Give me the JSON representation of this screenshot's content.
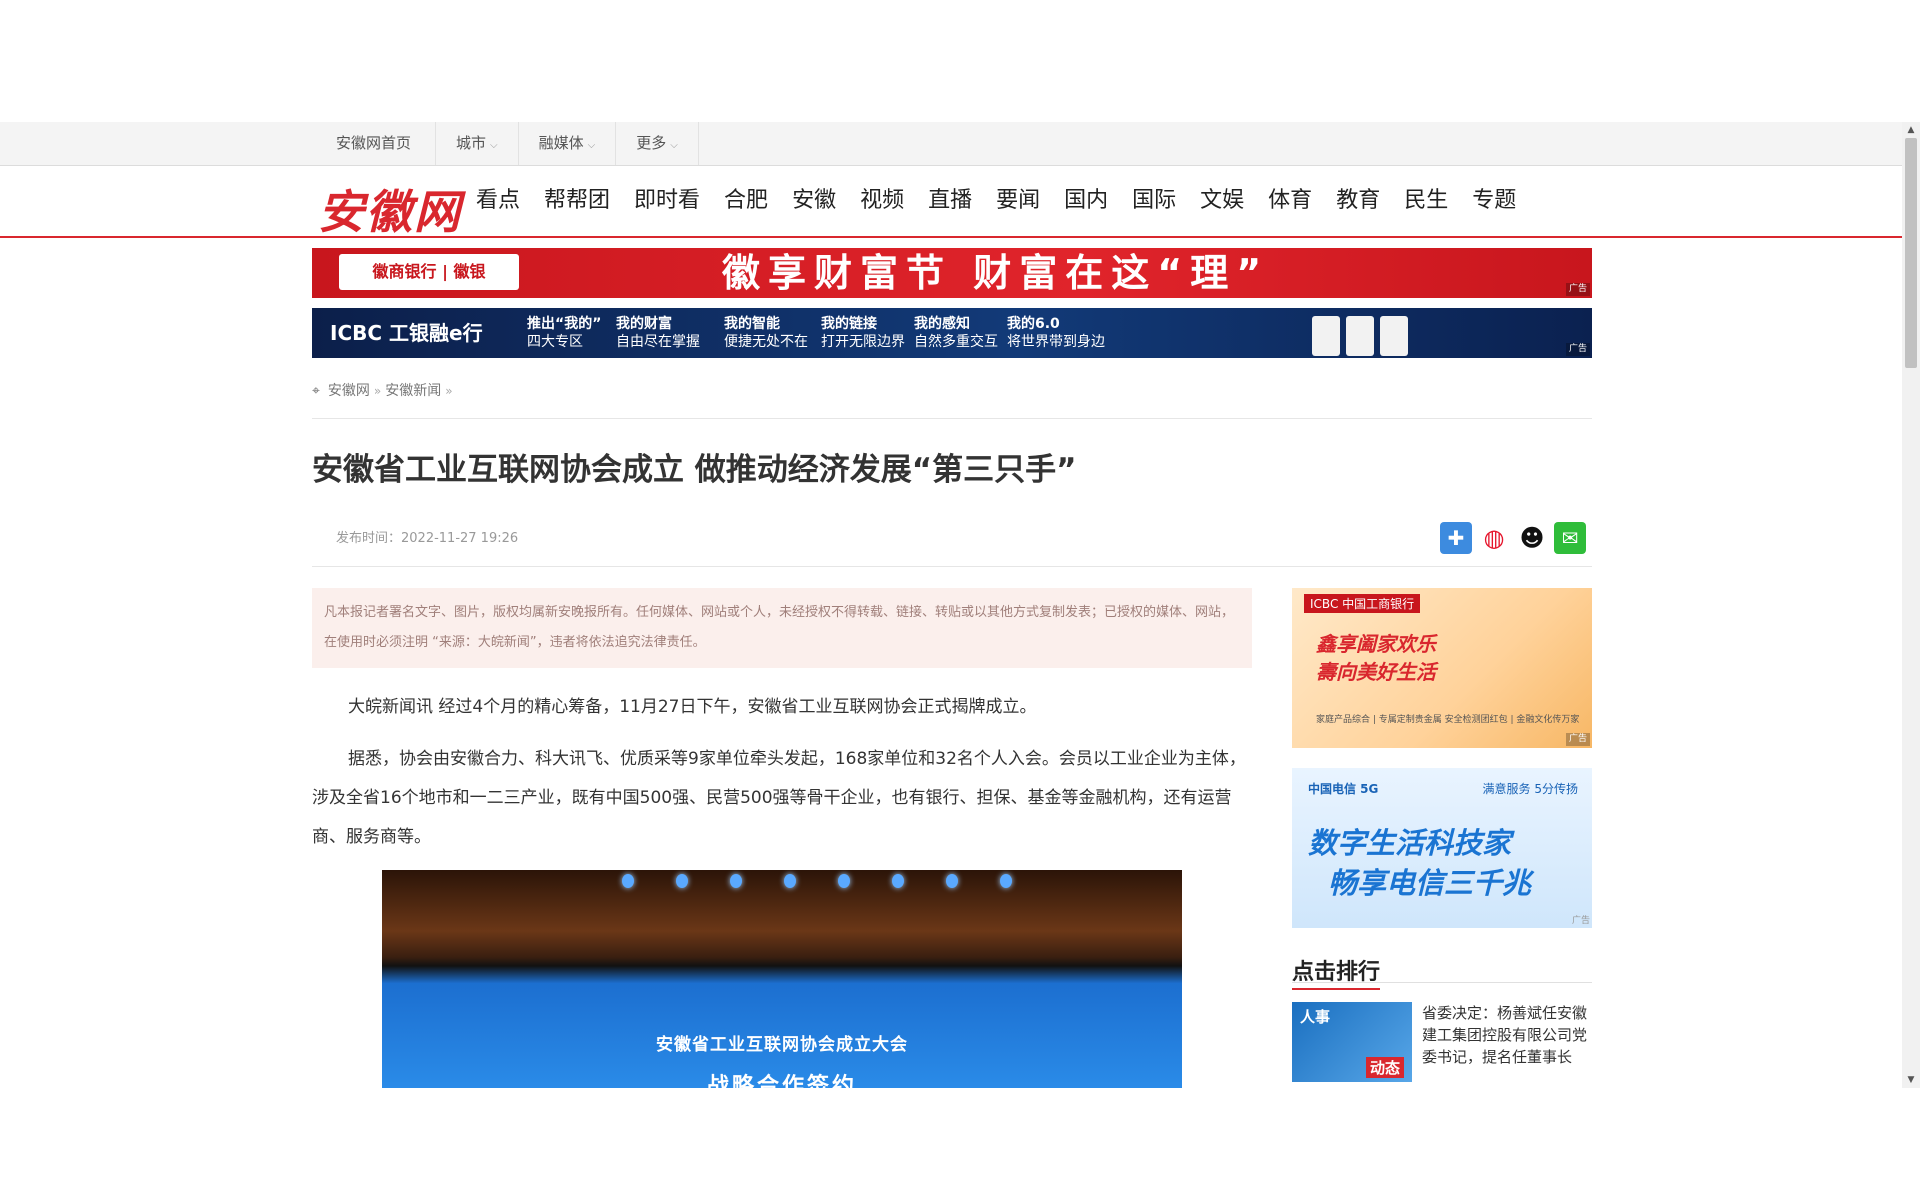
{
  "topbar": {
    "items": [
      {
        "label": "安徽网首页",
        "has_caret": false
      },
      {
        "label": "城市",
        "has_caret": true
      },
      {
        "label": "融媒体",
        "has_caret": true
      },
      {
        "label": "更多",
        "has_caret": true
      }
    ]
  },
  "header": {
    "logo_text": "安徽网",
    "nav": [
      "看点",
      "帮帮团",
      "即时看",
      "合肥",
      "安徽",
      "视频",
      "直播",
      "要闻",
      "国内",
      "国际",
      "文娱",
      "体育",
      "教育",
      "民生",
      "专题"
    ]
  },
  "banners": {
    "banner1": {
      "bank": "徽商银行 | 徽银",
      "slogan": "徽享财富节  财富在这“理”",
      "ad_label": "广告"
    },
    "banner2": {
      "brand": "ICBC 工银融e行",
      "features": [
        {
          "bold": "推出“我的”",
          "sub": "四大专区"
        },
        {
          "bold": "我的财富",
          "sub": "自由尽在掌握"
        },
        {
          "bold": "我的智能",
          "sub": "便捷无处不在"
        },
        {
          "bold": "我的链接",
          "sub": "打开无限边界"
        },
        {
          "bold": "我的感知",
          "sub": "自然多重交互"
        },
        {
          "bold": "我的6.0",
          "sub": "将世界带到身边"
        }
      ],
      "ad_label": "广告"
    }
  },
  "breadcrumb": {
    "items": [
      "安徽网",
      "安徽新闻"
    ],
    "separator": "»"
  },
  "article": {
    "title": "安徽省工业互联网协会成立 做推动经济发展“第三只手”",
    "meta": "发布时间：2022-11-27 19:26",
    "notice": "凡本报记者署名文字、图片，版权均属新安晚报所有。任何媒体、网站或个人，未经授权不得转载、链接、转贴或以其他方式复制发表；已授权的媒体、网站，在使用时必须注明 “来源：大皖新闻”，违者将依法追究法律责任。",
    "paragraphs": [
      "大皖新闻讯  经过4个月的精心筹备，11月27日下午，安徽省工业互联网协会正式揭牌成立。",
      "据悉，协会由安徽合力、科大讯飞、优质采等9家单位牵头发起，168家单位和32名个人入会。会员以工业企业为主体，涉及全省16个地市和一二三产业，既有中国500强、民营500强等骨干企业，也有银行、担保、基金等金融机构，还有运营商、服务商等。"
    ],
    "photo": {
      "screen_title": "安徽省工业互联网协会成立大会",
      "screen_sub": "战略合作签约"
    }
  },
  "share": [
    "plus-share-icon",
    "weibo-icon",
    "qq-icon",
    "wechat-icon"
  ],
  "sidebar": {
    "ad1": {
      "brand": "ICBC 中国工商银行",
      "line1": "鑫享阖家欢乐",
      "line2": "壽向美好生活",
      "foot": "家庭产品综合 | 专属定制贵金属\n安全检测团红包 | 金融文化传万家",
      "ad_label": "广告"
    },
    "ad2": {
      "brand": "中国电信 5G",
      "brand2": "满意服务 5分传扬",
      "line1": "数字生活科技家",
      "line2": "畅享电信三千兆",
      "ad_label": "广告"
    },
    "rank_title": "点击排行",
    "rank_items": [
      {
        "thumb_top": "人事",
        "thumb_bottom": "动态",
        "title": "省委决定：杨善斌任安徽建工集团控股有限公司党委书记，提名任董事长"
      }
    ]
  },
  "colors": {
    "brand_red": "#d9272e",
    "notice_bg": "#fbefec"
  }
}
